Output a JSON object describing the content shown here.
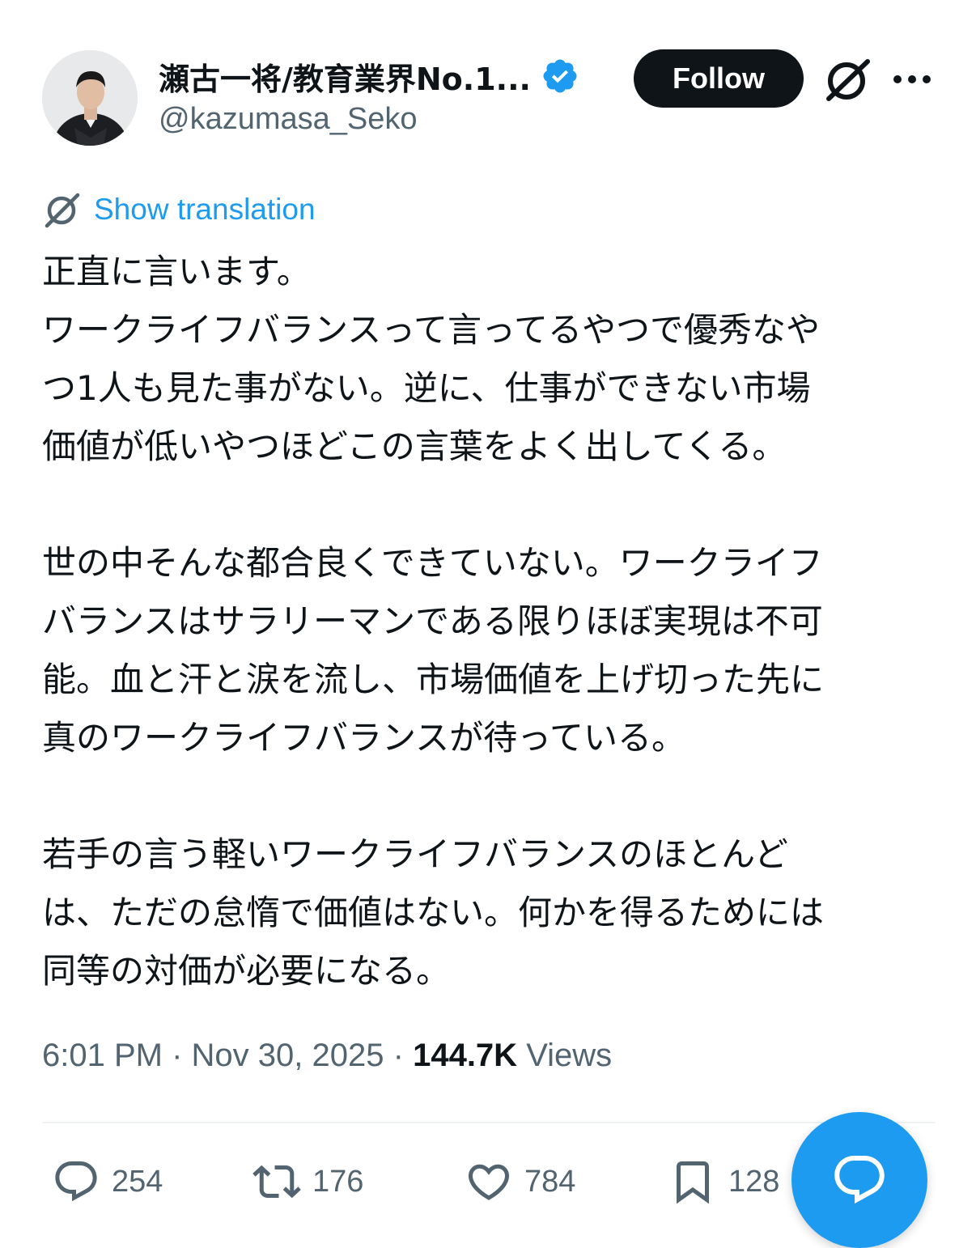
{
  "author": {
    "display_name": "瀬古一将/教育業界No.1...",
    "handle": "@kazumasa_Seko",
    "verified": true
  },
  "header": {
    "follow_label": "Follow",
    "grok_icon": "grok-icon",
    "more_icon": "more-icon"
  },
  "translation": {
    "label": "Show translation"
  },
  "tweet": {
    "paragraphs": [
      [
        "正直に言います。",
        "ワークライフバランスって言ってるやつで優秀なや",
        "つ1人も見た事がない。逆に、仕事ができない市場",
        "価値が低いやつほどこの言葉をよく出してくる。"
      ],
      [
        "世の中そんな都合良くできていない。ワークライフ",
        "バランスはサラリーマンである限りほぼ実現は不可",
        "能。血と汗と涙を流し、市場価値を上げ切った先に",
        "真のワークライフバランスが待っている。"
      ],
      [
        "若手の言う軽いワークライフバランスのほとんど",
        "は、ただの怠惰で価値はない。何かを得るためには",
        "同等の対価が必要になる。"
      ]
    ]
  },
  "meta": {
    "time": "6:01 PM",
    "separator": "·",
    "date": "Nov 30, 2025",
    "views_count": "144.7K",
    "views_label": "Views"
  },
  "actions": {
    "replies": "254",
    "reposts": "176",
    "likes": "784",
    "bookmarks": "128"
  },
  "colors": {
    "accent": "#1d9bf0",
    "text": "#0f1419",
    "secondary": "#536471"
  }
}
